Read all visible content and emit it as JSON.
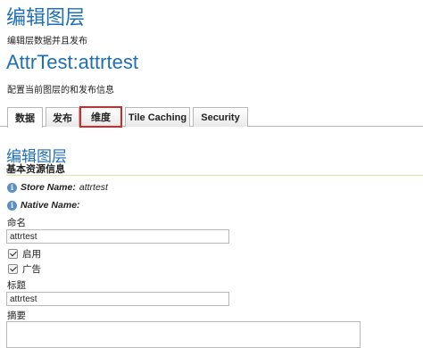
{
  "header": {
    "title": "编辑图层",
    "description": "编辑层数据并且发布",
    "layer_name": "AttrTest:attrtest",
    "layer_description": "配置当前图层的和发布信息"
  },
  "tabs": [
    {
      "label": "数据",
      "active": true
    },
    {
      "label": "发布",
      "active": false
    },
    {
      "label": "维度",
      "active": false,
      "highlighted": true
    },
    {
      "label": "Tile Caching",
      "active": false
    },
    {
      "label": "Security",
      "active": false
    }
  ],
  "section": {
    "title": "编辑图层",
    "subtitle": "基本资源信息"
  },
  "info": {
    "store_label": "Store Name:",
    "store_value": "attrtest",
    "native_label": "Native Name:",
    "native_value": ""
  },
  "form": {
    "name_label": "命名",
    "name_value": "attrtest",
    "enabled_label": "启用",
    "enabled_checked": true,
    "advertised_label": "广告",
    "advertised_checked": true,
    "title_label": "标题",
    "title_value": "attrtest",
    "abstract_label": "摘要",
    "abstract_value": ""
  },
  "colors": {
    "heading_blue": "#1f6fb6",
    "highlight_red": "#d62828",
    "divider_green": "#d7e5a8"
  }
}
